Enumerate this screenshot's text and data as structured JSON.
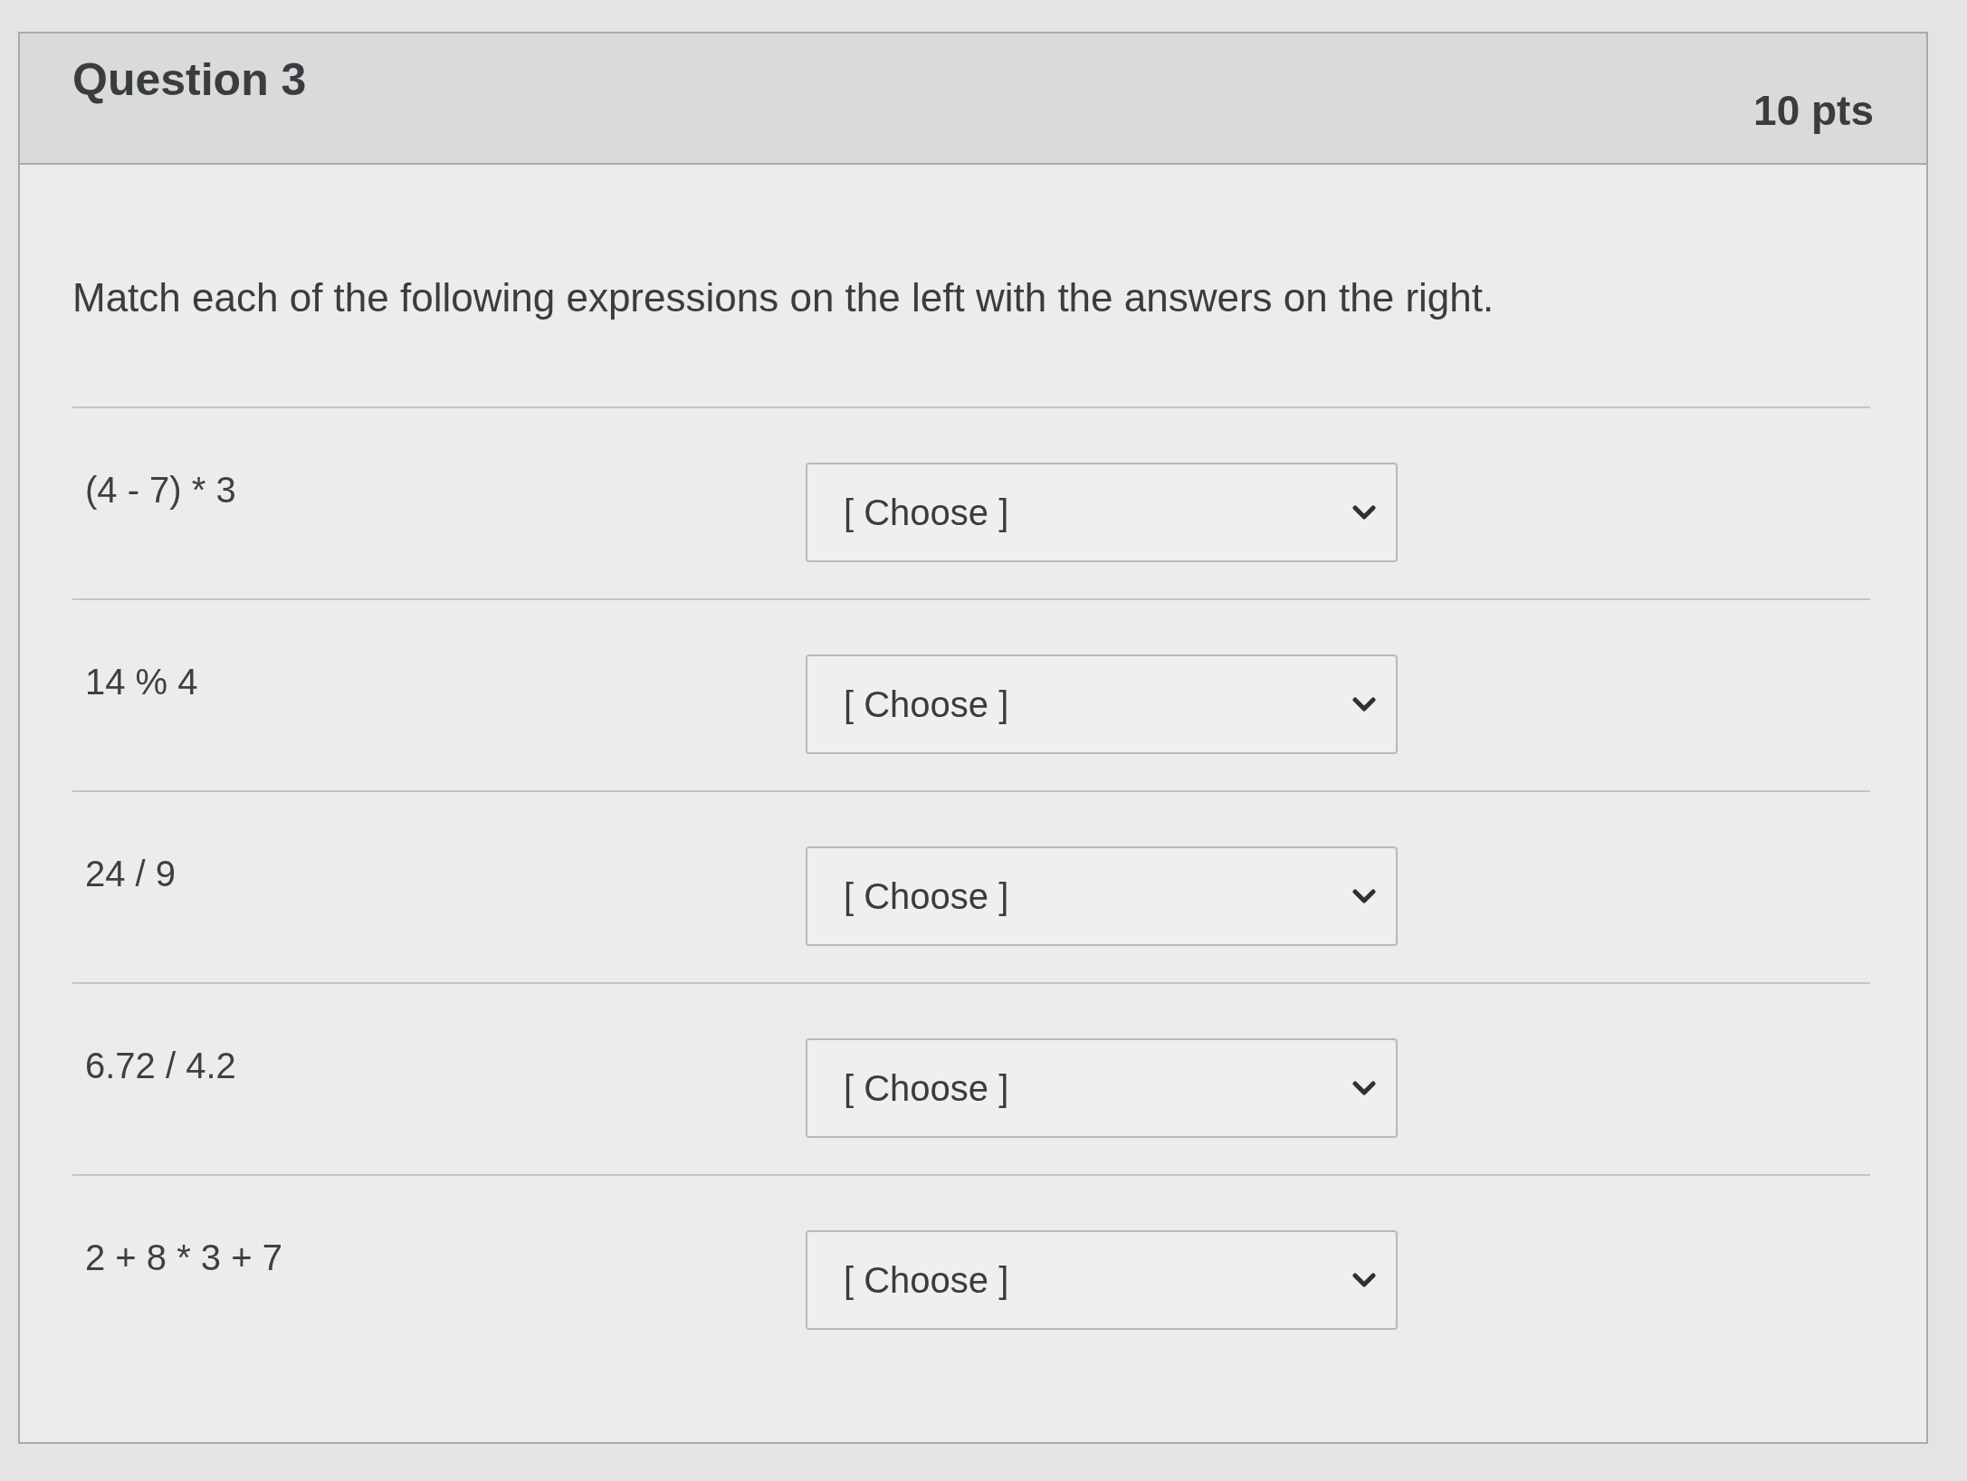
{
  "question": {
    "title": "Question 3",
    "points": "10 pts"
  },
  "prompt": "Match each of the following expressions on the left with the answers on the right.",
  "matches": [
    {
      "expression": "(4 - 7) * 3",
      "answer": "[ Choose ]"
    },
    {
      "expression": "14 % 4",
      "answer": "[ Choose ]"
    },
    {
      "expression": "24 / 9",
      "answer": "[ Choose ]"
    },
    {
      "expression": "6.72 / 4.2",
      "answer": "[ Choose ]"
    },
    {
      "expression": "2 + 8 * 3 + 7",
      "answer": "[ Choose ]"
    }
  ]
}
